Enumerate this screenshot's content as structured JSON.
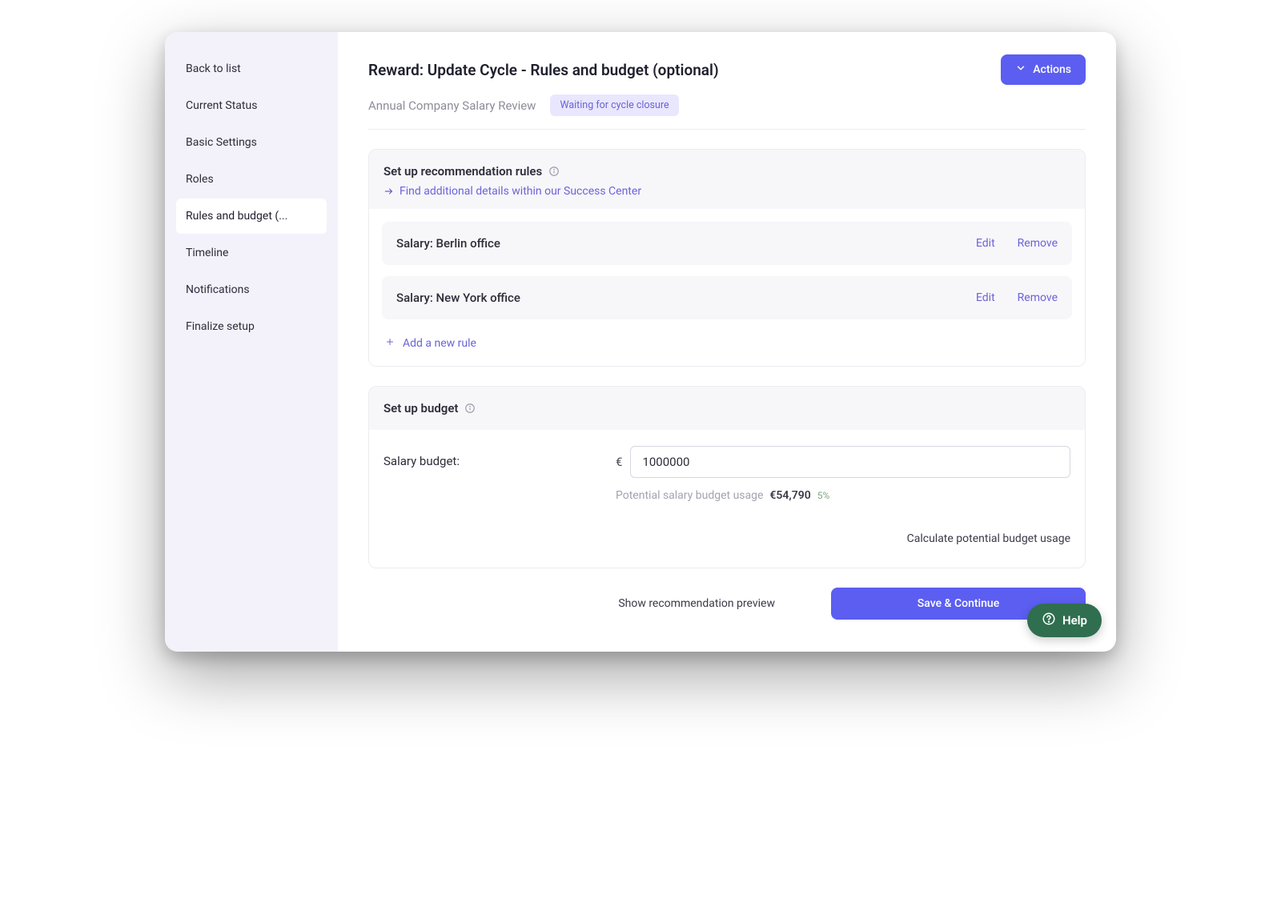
{
  "sidebar": {
    "items": [
      {
        "label": "Back to list"
      },
      {
        "label": "Current Status"
      },
      {
        "label": "Basic Settings"
      },
      {
        "label": "Roles"
      },
      {
        "label": "Rules and budget (..."
      },
      {
        "label": "Timeline"
      },
      {
        "label": "Notifications"
      },
      {
        "label": "Finalize setup"
      }
    ],
    "active_index": 4
  },
  "header": {
    "title": "Reward: Update Cycle - Rules and budget (optional)",
    "actions_label": "Actions",
    "subtitle": "Annual Company Salary Review",
    "status_badge": "Waiting for cycle closure"
  },
  "rules_section": {
    "title": "Set up recommendation rules",
    "link_text": "Find additional details within our Success Center",
    "rules": [
      {
        "name": "Salary: Berlin office",
        "edit": "Edit",
        "remove": "Remove"
      },
      {
        "name": "Salary: New York office",
        "edit": "Edit",
        "remove": "Remove"
      }
    ],
    "add_rule_label": "Add a new rule"
  },
  "budget_section": {
    "title": "Set up budget",
    "label": "Salary budget:",
    "currency_symbol": "€",
    "input_value": "1000000",
    "usage_label": "Potential salary budget usage",
    "usage_value": "€54,790",
    "usage_pct": "5%",
    "calculate_label": "Calculate potential budget usage"
  },
  "footer": {
    "preview_label": "Show recommendation preview",
    "save_label": "Save & Continue"
  },
  "help": {
    "label": "Help"
  }
}
